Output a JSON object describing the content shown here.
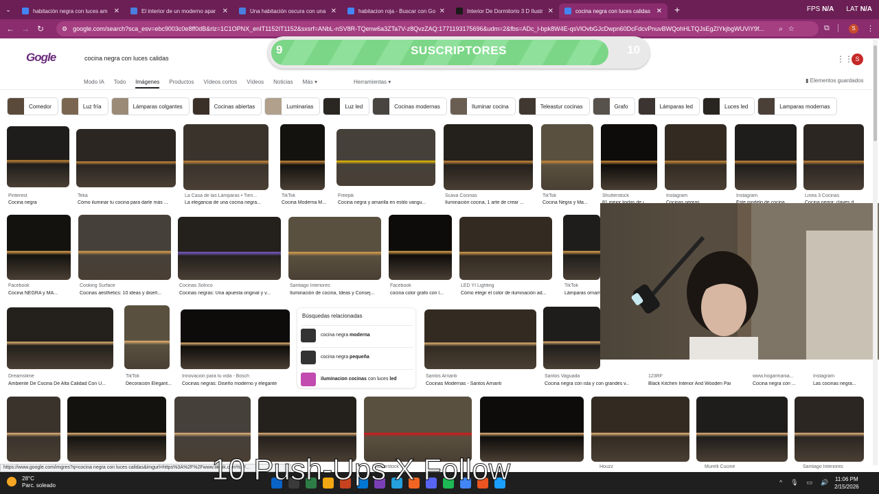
{
  "tabs": [
    {
      "title": "habitación negra con luces am",
      "icon": "google-icon",
      "color": "#4285f4"
    },
    {
      "title": "El interior de un moderno apar",
      "icon": "docs-icon",
      "color": "#4a7fe0"
    },
    {
      "title": "Una habitación oscura con una",
      "icon": "docs-icon",
      "color": "#4a7fe0"
    },
    {
      "title": "habitacion roja - Buscar con Go",
      "icon": "google-icon",
      "color": "#4285f4"
    },
    {
      "title": "Interior De Dormitorio 3 D Ilustr",
      "icon": "istock-icon",
      "color": "#1a1a1a"
    },
    {
      "title": "cocina negra con luces calidas",
      "icon": "google-icon",
      "color": "#4285f4"
    }
  ],
  "hud": {
    "fps": "FPS",
    "fps_val": "N/A",
    "lat": "LAT",
    "lat_val": "N/A"
  },
  "url": "google.com/search?sca_esv=ebc9003c0e8ff0dB&rlz=1C1OPNX_enIT1152IT1152&sxsrf=ANbL-nSV8R-TQenw6a3ZTa7V-z8QvzZAQ:1771193175696&udm=2&fbs=ADc_l-bpk8W4E-qsVlOvbGJcDwpn60DcFdcvPnuvBWQohHLTQJsEgZIYkjbgWUViY9f...",
  "profile_initial": "S",
  "logo": "Gogle",
  "search_query": "cocina negra con luces calidas",
  "subscribers": {
    "current": "9",
    "label": "SUSCRIPTORES",
    "goal": "10",
    "progress": 0.9
  },
  "nav": [
    "Modo IA",
    "Todo",
    "Imágenes",
    "Productos",
    "Vídeos cortos",
    "Vídeos",
    "Noticias",
    "Más ▾"
  ],
  "active_nav": "Imágenes",
  "tools": "Herramientas ▾",
  "saved": "Elementos guardados",
  "chips": [
    "Comedor",
    "Luz fría",
    "Lámparas colgantes",
    "Cocinas abiertas",
    "Luminarias",
    "Luz led",
    "Cocinas modernas",
    "Iluminar cocina",
    "Teleastur cocinas",
    "Grafo",
    "Lámparas led",
    "Luces led",
    "Lamparas modernas"
  ],
  "results_row1": [
    {
      "src": "Pinterest",
      "title": "Cocina negra"
    },
    {
      "src": "Teka",
      "title": "Cómo iluminar tu cocina para darle más ..."
    },
    {
      "src": "La Casa de las Lámparas • Tien...",
      "title": "La elegancia de una cocina negra..."
    },
    {
      "src": "TikTok",
      "title": "Cocina Moderna M..."
    },
    {
      "src": "Freepik",
      "title": "Cocina negra y amarilla en estilo vangu..."
    },
    {
      "src": "Scava Cocinas",
      "title": "Iluminación cocina, 1 arte de crear ..."
    },
    {
      "src": "TikTok",
      "title": "Cocina Negra y Ma..."
    },
    {
      "src": "Shutterstock",
      "title": "81 mejor lindas de i..."
    },
    {
      "src": "Instagram",
      "title": "Cocinas negras ..."
    },
    {
      "src": "Instagram",
      "title": "Este modelo de cocina..."
    },
    {
      "src": "Linea 3 Cocinas",
      "title": "Cocina negra: claves d..."
    }
  ],
  "results_row2": [
    {
      "src": "Facebook",
      "title": "Cocina NEGRA y MA..."
    },
    {
      "src": "Cooking Surface",
      "title": "Cocinas aesthetics: 10 ideas y diseñ..."
    },
    {
      "src": "Cocinas Solnco",
      "title": "Cocinas negras: Una apuesta original y v..."
    },
    {
      "src": "Santiago Interiores",
      "title": "Iluminación de cocina, Ideas y Consej..."
    },
    {
      "src": "Facebook",
      "title": "cocina color grafo con l..."
    },
    {
      "src": "LED YI Lighting",
      "title": "Cómo elegir el color de iluminación ad..."
    },
    {
      "src": "TikTok",
      "title": "Lámparas ornam..."
    }
  ],
  "results_row3": [
    {
      "src": "Dreamstime",
      "title": "Ambiente De Cocina De Alta Calidad Con U..."
    },
    {
      "src": "TikTok",
      "title": "Decoración Elegant..."
    },
    {
      "src": "Innovación para tu vida - Bosch",
      "title": "Cocinas negras: Diseño moderno y elegante"
    },
    {
      "src": "Santos Arrianti",
      "title": "Cocinas Modernas - Santos Arrianti"
    },
    {
      "src": "Santos Vaguada",
      "title": "Cocina negra con isla y con grandes v..."
    },
    {
      "src": "123RF",
      "title": "Black Kitchen Interior And Wooden Pan..."
    },
    {
      "src": "www.hogarmania...",
      "title": "Cocina negra con ..."
    },
    {
      "src": "Instagram",
      "title": "Las cocinas negra..."
    }
  ],
  "related": {
    "heading": "Búsquedas relacionadas",
    "items": [
      {
        "prefix": "cocina negra",
        "bold": "moderna",
        "suffix": ""
      },
      {
        "prefix": "cocina negra",
        "bold": "pequeña",
        "suffix": ""
      },
      {
        "prefix": "",
        "bold": "iluminacion cocinas",
        "suffix": " con luces ",
        "bold2": "led"
      }
    ]
  },
  "row4_sources": [
    "",
    "",
    "",
    "",
    "Shutterstock",
    "",
    "Houzz",
    "Murelli Cucine",
    "Santiago Interiores"
  ],
  "status_url": "https://www.google.com/imgres?q=cocina negra con luces calidas&imgurl=https%3A%2F%2Fwww.tiktok.com%2F...",
  "overlay_text": "10 Push-Ups X Follow",
  "taskbar": {
    "temp": "28°C",
    "weather": "Parc. soleado",
    "time": "11:06 PM",
    "date": "2/15/2026"
  }
}
